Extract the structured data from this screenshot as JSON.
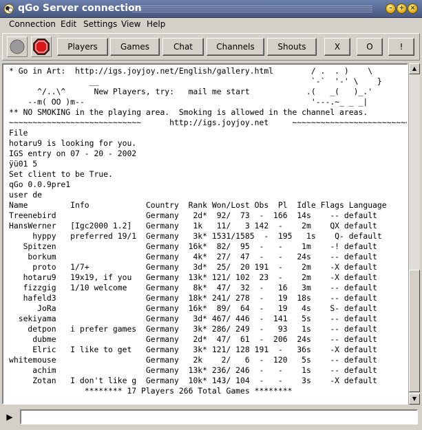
{
  "window": {
    "title": "qGo Server connection",
    "controls": [
      "minimize",
      "maximize",
      "close"
    ]
  },
  "menubar": {
    "items": [
      "Connection",
      "Edit",
      "Settings",
      "View",
      "Help"
    ]
  },
  "toolbar": {
    "status_button_color": "#9a9a9a",
    "stop_button_color": "#d81818",
    "buttons": [
      "Players",
      "Games",
      "Chat",
      "Channels",
      "Shouts",
      "X",
      "O",
      "!"
    ]
  },
  "console": {
    "lines": [
      "* Go in Art:  http://igs.joyjoy.net/English/gallery.html        / .  . )    \\",
      "                 __                                             `-`  '-' \\    }",
      "      ^/..\\^      New Players, try:   mail me start            .(   _(   )_.'",
      "    --m( OO )m--                                                '---.~_ _ _|",
      "** NO SMOKING in the playing area.  Smoking is allowed in the channel areas.",
      "~~~~~~~~~~~~~~~~~~~~~~~~~~~~      http://igs.joyjoy.net     ~~~~~~~~~~~~~~~~~~~~~~~~~~~~~",
      "File",
      "hotaru9 is looking for you.",
      "IGS entry on 07 - 20 - 2002",
      "ÿü01 5",
      "Set client to be True.",
      "qGo 0.0.9pre1",
      "user de",
      "Name         Info            Country  Rank Won/Lost Obs  Pl  Idle Flags Language",
      "Treenebird                   Germany   2d*  92/  73  -  166  14s    -- default",
      "HansWerner   [Igc2000 1.2]   Germany   1k   11/   3 142  -    2m    QX default",
      "     hyppy   preferred 19/1  Germany   3k* 1531/1585  -  195   1s    Q- default",
      "   Spitzen                   Germany  16k*  82/  95  -   -    1m    -! default",
      "    borkum                   Germany   4k*  27/  47  -   -   24s    -- default",
      "     proto   1/7+            Germany   3d*  25/  20 191  -    2m    -X default",
      "   hotaru9   19x19, if you   Germany  13k* 121/ 102  23  -    2m    -X default",
      "   fizzgig   1/10 welcome    Germany   8k*  47/  32  -   16   3m    -- default",
      "   hafeld3                   Germany  18k* 241/ 278  -   19  18s    -- default",
      "      JoRa                   Germany  16k*  89/  64  -   19   4s    S- default",
      "  sekiyama                   Germany   3d* 467/ 446  -  141   5s    -- default",
      "    detpon   i prefer games  Germany   3k* 286/ 249  -   93   1s    -- default",
      "     dubme                   Germany   2d*  47/  61  -  206  24s    -- default",
      "     Elric   I like to get   Germany   3k* 121/ 128 191  -   36s    -X default",
      "whitemouse                   Germany   2k    2/   6  -  120   5s    -- default",
      "     achim                   Germany  13k* 236/ 246  -   -    1s    -- default",
      "     Zotan   I don't like g  Germany  10k* 143/ 104  -   -    3s    -X default",
      "                ******** 17 Players 266 Total Games ********"
    ]
  },
  "input": {
    "value": ""
  }
}
